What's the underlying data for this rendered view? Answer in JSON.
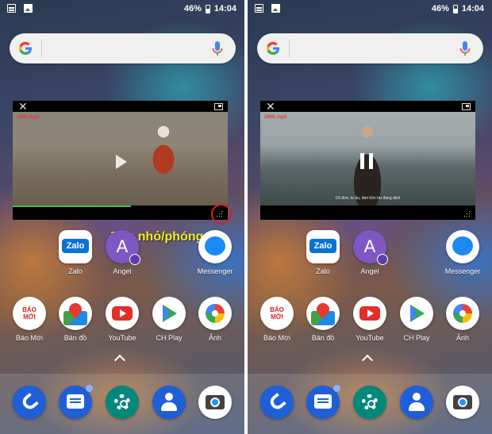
{
  "status_bar": {
    "battery": "46%",
    "time": "14:04"
  },
  "annotation": "Thu nhỏ/phóng to",
  "video": {
    "channel_logo": "ZING mp3",
    "subtitle": "Cô đơn, lo âu, tâm hồn hư đang dịch"
  },
  "apps_row1": [
    {
      "label": "Zalo",
      "icon": "zalo-icon"
    },
    {
      "label": "Angel",
      "icon": "contact-a-icon"
    },
    {
      "label": "Messenger",
      "icon": "messenger-icon"
    }
  ],
  "apps_row2": [
    {
      "label": "Báo Mới",
      "icon": "bao-moi-icon"
    },
    {
      "label": "Bản đồ",
      "icon": "maps-icon"
    },
    {
      "label": "YouTube",
      "icon": "youtube-icon"
    },
    {
      "label": "CH Play",
      "icon": "play-store-icon"
    },
    {
      "label": "Ảnh",
      "icon": "photos-icon"
    }
  ],
  "dock": [
    "phone-icon",
    "messages-icon",
    "settings-icon",
    "contacts-icon",
    "camera-icon"
  ],
  "colors": {
    "annotation": "#f6ec1a",
    "highlight": "#e02020",
    "progress": "#39c24a"
  }
}
